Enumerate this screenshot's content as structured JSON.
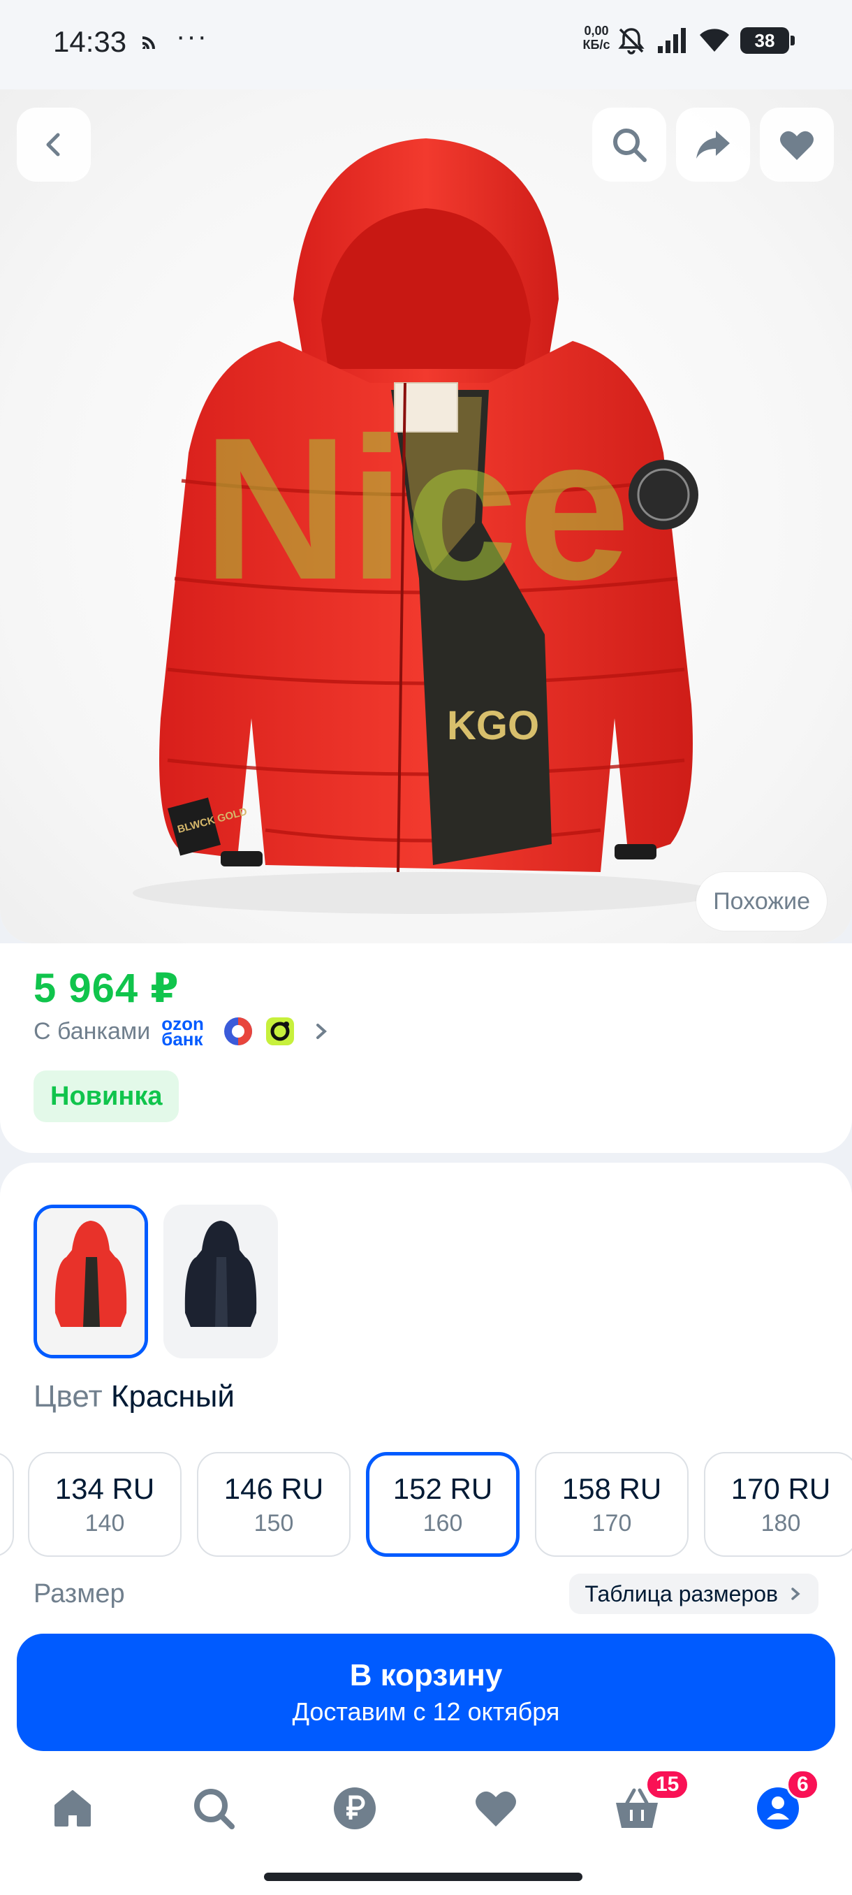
{
  "status_bar": {
    "time": "14:33",
    "dots": "···",
    "speed_value": "0,00",
    "speed_unit": "КБ/с",
    "battery": "38"
  },
  "product": {
    "similar_label": "Похожие",
    "price": "5 964 ₽",
    "banks_label": "С банками",
    "ozon_bank_logo_line1": "ozon",
    "ozon_bank_logo_line2": "банк",
    "badge": "Новинка",
    "jacket_logo_text": "BLWCK GOLD",
    "jacket_lining_text": "KGO",
    "watermark_text": "Nice"
  },
  "variants": {
    "color_key": "Цвет",
    "color_value": "Красный",
    "colors": [
      {
        "name": "red",
        "hex": "#e8322a"
      },
      {
        "name": "black",
        "hex": "#1c2230"
      }
    ],
    "sizes": [
      {
        "main": "134 RU",
        "sub": "140"
      },
      {
        "main": "146 RU",
        "sub": "150"
      },
      {
        "main": "152 RU",
        "sub": "160"
      },
      {
        "main": "158 RU",
        "sub": "170"
      },
      {
        "main": "170 RU",
        "sub": "180"
      }
    ],
    "selected_size_index": 2,
    "size_label": "Размер",
    "size_table_label": "Таблица размеров"
  },
  "cart": {
    "title": "В корзину",
    "subtitle": "Доставим с 12 октября"
  },
  "nav": {
    "cart_badge": "15",
    "profile_badge": "6"
  },
  "colors": {
    "accent": "#005bff",
    "price_green": "#10c44c",
    "badge_pink": "#f91155",
    "muted_text": "#707f8d"
  }
}
